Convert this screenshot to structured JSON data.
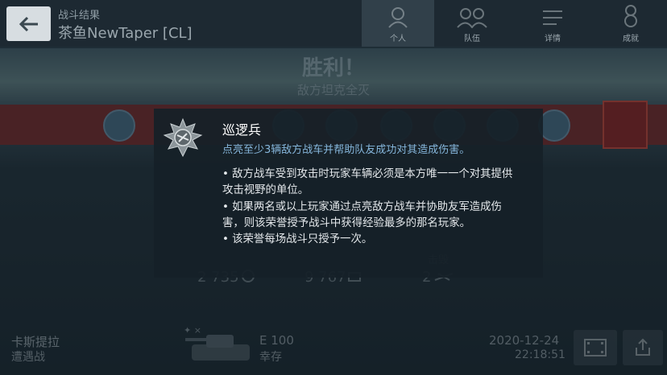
{
  "header": {
    "subtitle": "战斗结果",
    "player_name": "茶鱼NewTaper [CL]",
    "tabs": [
      {
        "label": "个人",
        "icon": "soldier-icon",
        "active": true
      },
      {
        "label": "队伍",
        "icon": "team-icon",
        "active": false
      },
      {
        "label": "详情",
        "icon": "list-icon",
        "active": false
      },
      {
        "label": "成就",
        "icon": "medal-icon",
        "active": false
      }
    ]
  },
  "result": {
    "title": "胜利！",
    "subtitle": "敌方坦克全灭"
  },
  "stats": [
    {
      "value": "2 735",
      "icon": "damage-icon"
    },
    {
      "value": "9 767",
      "icon": "blocked-icon"
    },
    {
      "label": "击毁",
      "value": "2",
      "icon": "kill-icon"
    }
  ],
  "footer": {
    "map": "卡斯提拉",
    "mode": "遭遇战",
    "tank": "E 100",
    "survival": "幸存",
    "date": "2020-12-24",
    "time": "22:18:51",
    "replay_icon": "film-icon",
    "share_icon": "share-icon"
  },
  "popup": {
    "medal_icon": "patrol-medal-icon",
    "name": "巡逻兵",
    "condition": "点亮至少3辆敌方战车并帮助队友成功对其造成伤害。",
    "details": [
      "• 敌方战车受到攻击时玩家车辆必须是本方唯一一个对其提供攻击视野的单位。",
      "• 如果两名或以上玩家通过点亮敌方战车并协助友军造成伤害，则该荣誉授予战斗中获得经验最多的那名玩家。",
      "• 该荣誉每场战斗只授予一次。"
    ]
  },
  "colors": {
    "condition_text": "#86b6db",
    "back_button": "#d7dde1",
    "medal_strip": "#7a2d2d"
  }
}
